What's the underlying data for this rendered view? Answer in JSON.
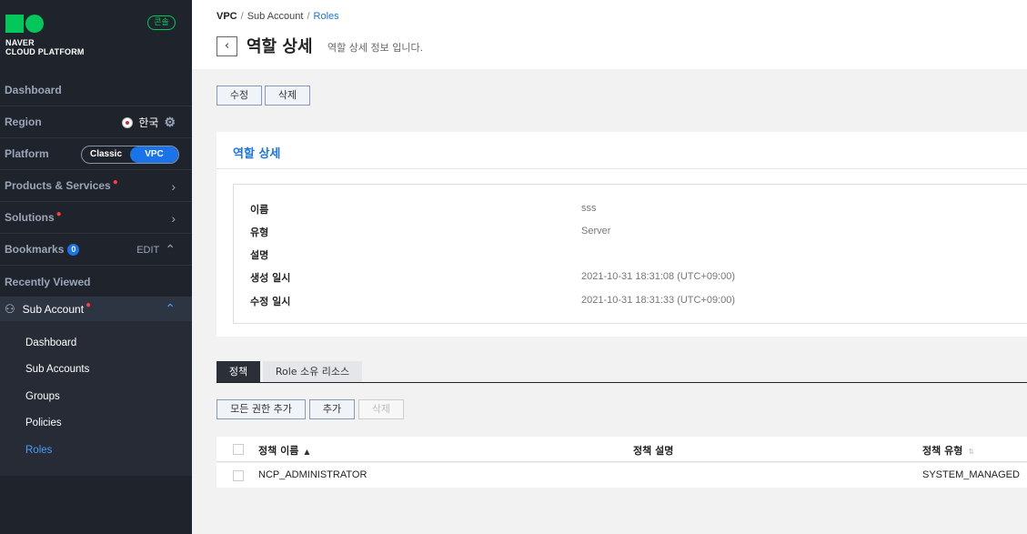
{
  "brand": {
    "line1": "NAVER",
    "line2": "CLOUD PLATFORM",
    "console_label": "콘솔"
  },
  "sidebar": {
    "dashboard": "Dashboard",
    "region": {
      "label": "Region",
      "value": "한국"
    },
    "platform": {
      "label": "Platform",
      "classic": "Classic",
      "vpc": "VPC"
    },
    "products": "Products & Services",
    "solutions": "Solutions",
    "bookmarks": {
      "label": "Bookmarks",
      "count": "0",
      "edit": "EDIT"
    },
    "recently_viewed": "Recently Viewed",
    "sub_account": {
      "label": "Sub Account",
      "items": [
        "Dashboard",
        "Sub Accounts",
        "Groups",
        "Policies",
        "Roles"
      ],
      "active_index": 4
    }
  },
  "breadcrumb": {
    "root": "VPC",
    "middle": "Sub Account",
    "current": "Roles"
  },
  "page": {
    "title": "역할 상세",
    "subtitle": "역할 상세 정보 입니다."
  },
  "actions": {
    "edit": "수정",
    "delete": "삭제"
  },
  "detail": {
    "title": "역할 상세",
    "fields": [
      {
        "label": "이름",
        "value": "sss"
      },
      {
        "label": "유형",
        "value": "Server"
      },
      {
        "label": "설명",
        "value": ""
      },
      {
        "label": "생성 일시",
        "value": "2021-10-31 18:31:08 (UTC+09:00)"
      },
      {
        "label": "수정 일시",
        "value": "2021-10-31 18:31:33 (UTC+09:00)"
      }
    ]
  },
  "tabs": [
    {
      "label": "정책",
      "active": true
    },
    {
      "label": "Role 소유 리소스",
      "active": false
    }
  ],
  "policy_actions": {
    "add_all": "모든 권한 추가",
    "add": "추가",
    "delete": "삭제"
  },
  "table": {
    "columns": [
      "정책 이름",
      "정책 설명",
      "정책 유형"
    ],
    "rows": [
      [
        "NCP_ADMINISTRATOR",
        "",
        "SYSTEM_MANAGED"
      ]
    ]
  },
  "colors": {
    "accent": "#1a73e8",
    "brand": "#03c75a",
    "sidebar_bg": "#1f232c"
  }
}
